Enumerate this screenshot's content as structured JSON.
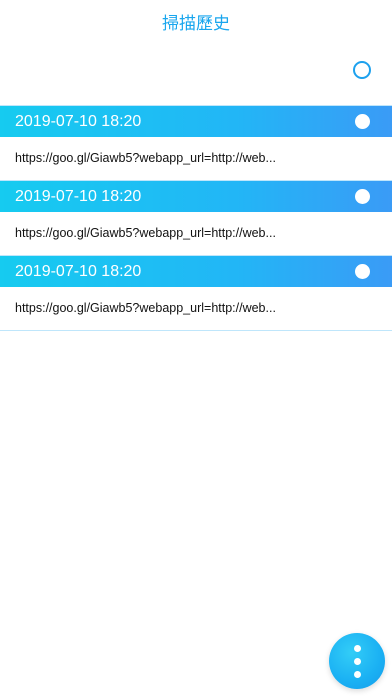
{
  "header": {
    "title": "掃描歷史"
  },
  "records": [
    {
      "date": "2019-07-10 18:20",
      "url": "https://goo.gl/Giawb5?webapp_url=http://web..."
    },
    {
      "date": "2019-07-10 18:20",
      "url": "https://goo.gl/Giawb5?webapp_url=http://web..."
    },
    {
      "date": "2019-07-10 18:20",
      "url": "https://goo.gl/Giawb5?webapp_url=http://web..."
    }
  ],
  "icons": {
    "select_all": "circle-outline-icon",
    "record_check": "circle-filled-icon",
    "fab": "more-vertical-icon"
  },
  "colors": {
    "accent": "#19a6ee",
    "header_gradient_start": "#16cbf0",
    "header_gradient_end": "#3a9bf6"
  }
}
